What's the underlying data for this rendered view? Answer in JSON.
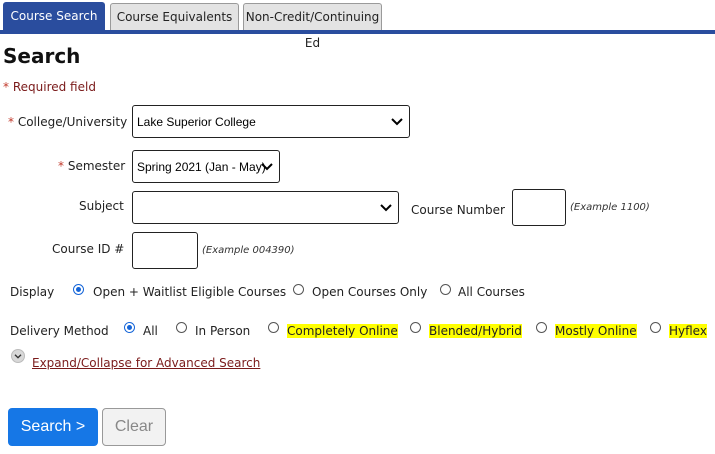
{
  "tabs": [
    {
      "label": "Course Search",
      "active": true
    },
    {
      "label": "Course Equivalents",
      "active": false
    },
    {
      "label": "Non-Credit/Continuing Ed",
      "active": false
    }
  ],
  "page_title": "Search",
  "required_star": "*",
  "required_note": "Required field",
  "fields": {
    "college": {
      "label": "College/University",
      "value": "Lake Superior College"
    },
    "semester": {
      "label": "Semester",
      "value": "Spring 2021 (Jan - May)"
    },
    "subject": {
      "label": "Subject",
      "value": ""
    },
    "course_number": {
      "label": "Course Number",
      "value": "",
      "example": "(Example 1100)"
    },
    "course_id": {
      "label": "Course ID #",
      "value": "",
      "example": "(Example 004390)"
    }
  },
  "display": {
    "label": "Display",
    "options": [
      {
        "label": "Open + Waitlist Eligible Courses",
        "selected": true
      },
      {
        "label": "Open Courses Only",
        "selected": false
      },
      {
        "label": "All Courses",
        "selected": false
      }
    ]
  },
  "delivery": {
    "label": "Delivery Method",
    "options": [
      {
        "label": "All",
        "selected": true,
        "highlight": false
      },
      {
        "label": "In Person",
        "selected": false,
        "highlight": false
      },
      {
        "label": "Completely Online",
        "selected": false,
        "highlight": true
      },
      {
        "label": "Blended/Hybrid",
        "selected": false,
        "highlight": true
      },
      {
        "label": "Mostly Online",
        "selected": false,
        "highlight": true
      },
      {
        "label": "Hyflex",
        "selected": false,
        "highlight": true
      }
    ]
  },
  "advanced_link": "Expand/Collapse for Advanced Search",
  "buttons": {
    "search": "Search >",
    "clear": "Clear"
  },
  "colors": {
    "tab_active": "#2a4d9e",
    "search_button": "#1677e6",
    "highlight": "#ffff00",
    "required": "#7a1a1a"
  }
}
